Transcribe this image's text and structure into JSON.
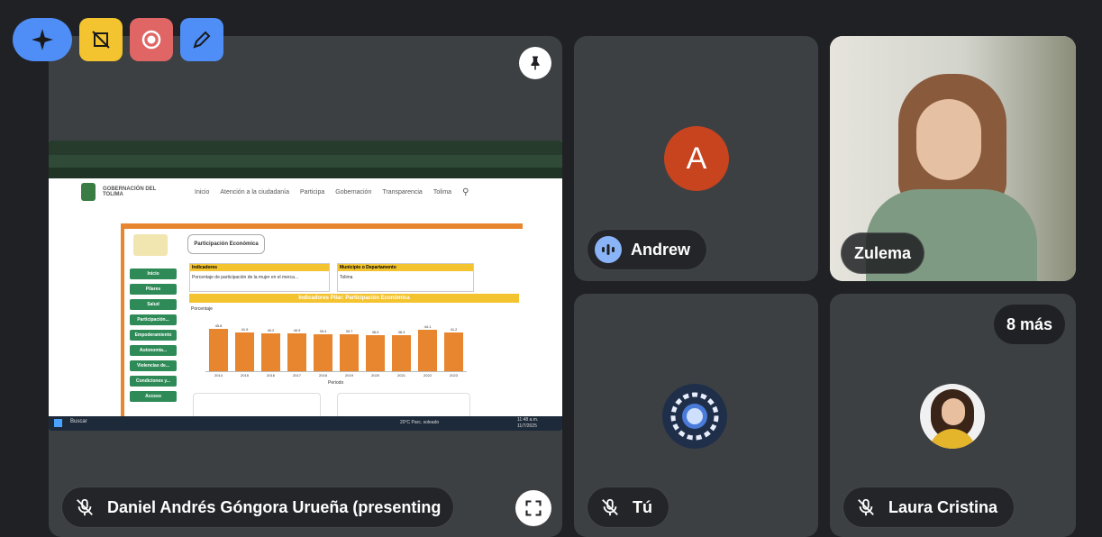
{
  "participants": {
    "presenter": {
      "name": "Daniel Andrés Góngora Urueña (presenting)"
    },
    "andrew": {
      "initial": "A",
      "name": "Andrew",
      "avatar_color": "#c7441f"
    },
    "zulema": {
      "name": "Zulema"
    },
    "you": {
      "name": "Tú"
    },
    "laura": {
      "name": "Laura Cristina"
    },
    "more": {
      "label": "8 más"
    }
  },
  "toolbar": {
    "icons": [
      "sparkle-icon",
      "frame-off-icon",
      "record-icon",
      "pen-icon"
    ],
    "colors": [
      "#4f8ef7",
      "#f4c430",
      "#e06666",
      "#4f8ef7"
    ]
  },
  "shared_screen": {
    "site_name": "GOBERNACIÓN DEL TOLIMA",
    "nav": [
      "Inicio",
      "Atención a la ciudadanía",
      "Participa",
      "Gobernación",
      "Transparencia",
      "Tolima"
    ],
    "section_title": "Participación Económica",
    "chart_title": "Indicadores Pilar: Participación Económica",
    "sidebar": [
      "Inicio",
      "Pilares",
      "Salud",
      "Participación...",
      "Empoderamiento",
      "Autonomía...",
      "Violencias de...",
      "Condiciones y...",
      "Acceso"
    ],
    "filter_labels": [
      "Indicadores",
      "Municipio o Departamento"
    ],
    "filter_values": [
      "Porcentaje de participación de la mujer en el merca...",
      "Tolima"
    ],
    "chart_label": "Porcentaje",
    "x_label": "Periodo",
    "taskbar_search": "Buscar",
    "weather": "20°C Parc. soleado",
    "clock": "11:48 a.m.",
    "date": "11/7/2025"
  },
  "chart_data": {
    "type": "bar",
    "title": "Indicadores Pilar: Participación Económica",
    "ylabel": "Porcentaje",
    "xlabel": "Periodo",
    "categories": [
      "2014",
      "2015",
      "2016",
      "2017",
      "2018",
      "2019",
      "2020",
      "2021",
      "2022",
      "2023"
    ],
    "values": [
      45.8,
      41.9,
      40.2,
      40.9,
      39.4,
      39.7,
      38.9,
      38.3,
      44.1,
      41.2
    ],
    "ylim": [
      0,
      60
    ]
  },
  "colors": {
    "background": "#202124",
    "tile": "#3c4043",
    "sidebar_green": "#2e8b57",
    "orange": "#e8852f",
    "yellow": "#f4c430"
  }
}
